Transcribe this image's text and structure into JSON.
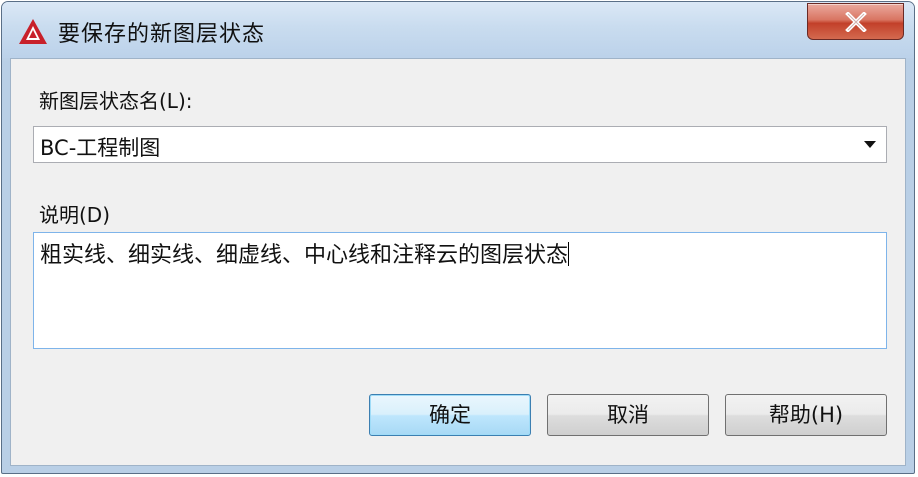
{
  "window": {
    "title": "要保存的新图层状态",
    "app_icon": "autocad-a-icon",
    "close_icon": "close-x-icon"
  },
  "form": {
    "name_label": "新图层状态名(L):",
    "name_value": "BC-工程制图",
    "dropdown_icon": "chevron-down-icon",
    "description_label": "说明(D)",
    "description_value": "粗实线、细实线、细虚线、中心线和注释云的图层状态"
  },
  "buttons": {
    "ok_label": "确定",
    "cancel_label": "取消",
    "help_label": "帮助(H)"
  },
  "colors": {
    "title_bar": "#c9dcef",
    "close_button": "#c7432c",
    "dialog_body": "#f0f0f0",
    "focus_border": "#7eb4ea",
    "default_button_border": "#3c7fb1",
    "app_icon_red": "#c8202a"
  }
}
